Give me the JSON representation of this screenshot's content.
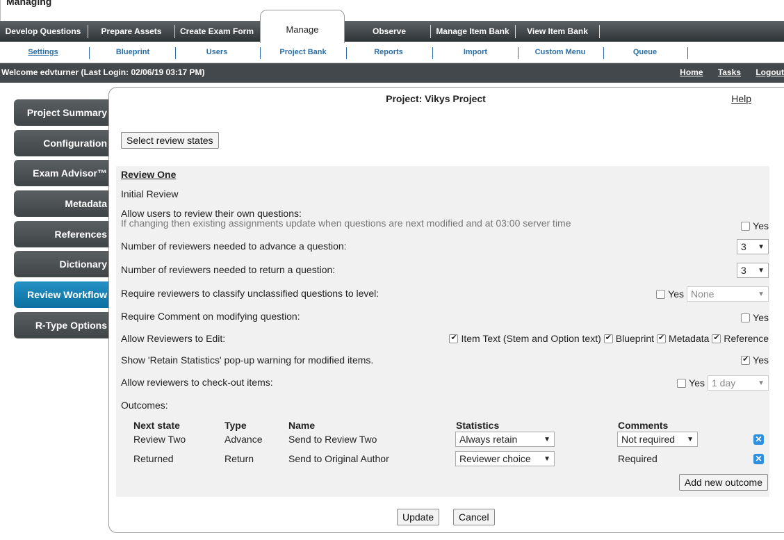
{
  "app": {
    "title": "Managing"
  },
  "tabs": [
    {
      "label": "Develop Questions"
    },
    {
      "label": "Prepare Assets"
    },
    {
      "label": "Create Exam Form"
    },
    {
      "label": "Manage"
    },
    {
      "label": "Observe"
    },
    {
      "label": "Manage Item Bank"
    },
    {
      "label": "View Item Bank"
    }
  ],
  "subnav": [
    {
      "label": "Settings"
    },
    {
      "label": "Blueprint"
    },
    {
      "label": "Users"
    },
    {
      "label": "Project Bank"
    },
    {
      "label": "Reports"
    },
    {
      "label": "Import"
    },
    {
      "label": "Custom Menu"
    },
    {
      "label": "Queue"
    }
  ],
  "welcome": {
    "prefix": "Welcome ",
    "user": "edvturner",
    "login": " (Last Login: 02/06/19   03:17 PM)",
    "full": "Welcome edvturner (Last Login: 02/06/19   03:17 PM)"
  },
  "toplinks": {
    "home": "Home",
    "tasks": "Tasks",
    "logout": "Logout"
  },
  "sidebar": [
    {
      "label": "Project Summary"
    },
    {
      "label": "Configuration"
    },
    {
      "label": "Exam Advisor™"
    },
    {
      "label": "Metadata"
    },
    {
      "label": "References"
    },
    {
      "label": "Dictionary"
    },
    {
      "label": "Review Workflow"
    },
    {
      "label": "R-Type Options"
    }
  ],
  "panel": {
    "title": "Project: Vikys Project",
    "help": "Help",
    "select_states": "Select review states"
  },
  "review": {
    "heading": "Review One",
    "initial": "Initial Review",
    "own": {
      "label": "Allow users to review their own questions:",
      "note": "If changing then existing assignments update when questions are next modified and at 03:00 server time",
      "yes": "Yes"
    },
    "advance": {
      "label": "Number of reviewers needed to advance a question:",
      "value": "3"
    },
    "return": {
      "label": "Number of reviewers needed to return a question:",
      "value": "3"
    },
    "classify": {
      "label": "Require reviewers to classify unclassified questions to level:",
      "yes": "Yes",
      "value": "None"
    },
    "comment": {
      "label": "Require Comment on modifying question:",
      "yes": "Yes"
    },
    "edit": {
      "label": "Allow Reviewers to Edit:",
      "options": [
        "Item Text (Stem and Option text)",
        "Blueprint",
        "Metadata",
        "Reference"
      ]
    },
    "retain": {
      "label": "Show 'Retain Statistics' pop-up warning for modified items.",
      "yes": "Yes"
    },
    "checkout": {
      "label": "Allow reviewers to check-out items:",
      "yes": "Yes",
      "value": "1 day"
    },
    "outcomes_label": "Outcomes:",
    "outcome_headers": {
      "next": "Next state",
      "type": "Type",
      "name": "Name",
      "stats": "Statistics",
      "comments": "Comments"
    },
    "outcomes": [
      {
        "next": "Review Two",
        "type": "Advance",
        "name": "Send to Review Two",
        "stats": "Always retain",
        "comments": "Not required"
      },
      {
        "next": "Returned",
        "type": "Return",
        "name": "Send to Original Author",
        "stats": "Reviewer choice",
        "comments": "Required"
      }
    ],
    "add_outcome": "Add new outcome"
  },
  "actions": {
    "update": "Update",
    "cancel": "Cancel"
  },
  "colors": {
    "accent": "#0c6f9f",
    "nav_dark": "#43484c",
    "link": "#2a6ea5",
    "delete": "#2d8fe0"
  }
}
